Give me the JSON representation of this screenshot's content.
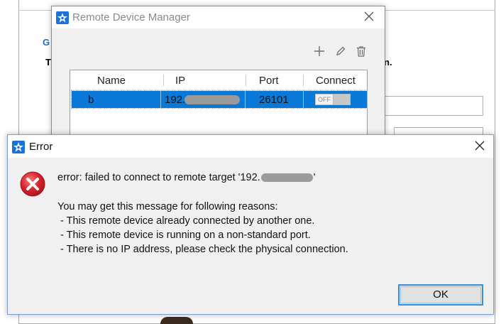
{
  "background": {
    "heading_fragment": "G",
    "text_fragment_left": "T",
    "text_fragment_right": "n."
  },
  "remote_device_manager": {
    "title": "Remote Device Manager",
    "toolbar": {
      "add_icon": "plus-icon",
      "edit_icon": "pencil-icon",
      "delete_icon": "trash-icon"
    },
    "columns": [
      "Name",
      "IP",
      "Port",
      "Connect"
    ],
    "rows": [
      {
        "name": "b",
        "ip": "192.",
        "port": "26101",
        "connect": "OFF"
      }
    ]
  },
  "error_dialog": {
    "title": "Error",
    "message": "error: failed to connect to remote target '192.",
    "message_end": "'",
    "reasons_intro": "You may get this message for following reasons:",
    "reasons": [
      " - This remote device already connected by another one.",
      " - This remote device is running on a non-standard port.",
      " - There is no IP address, please check the physical connection."
    ],
    "ok_label": "OK"
  },
  "colors": {
    "selection_blue": "#0a78d6",
    "error_red": "#d9232c",
    "link_blue": "#1f6fbf"
  }
}
